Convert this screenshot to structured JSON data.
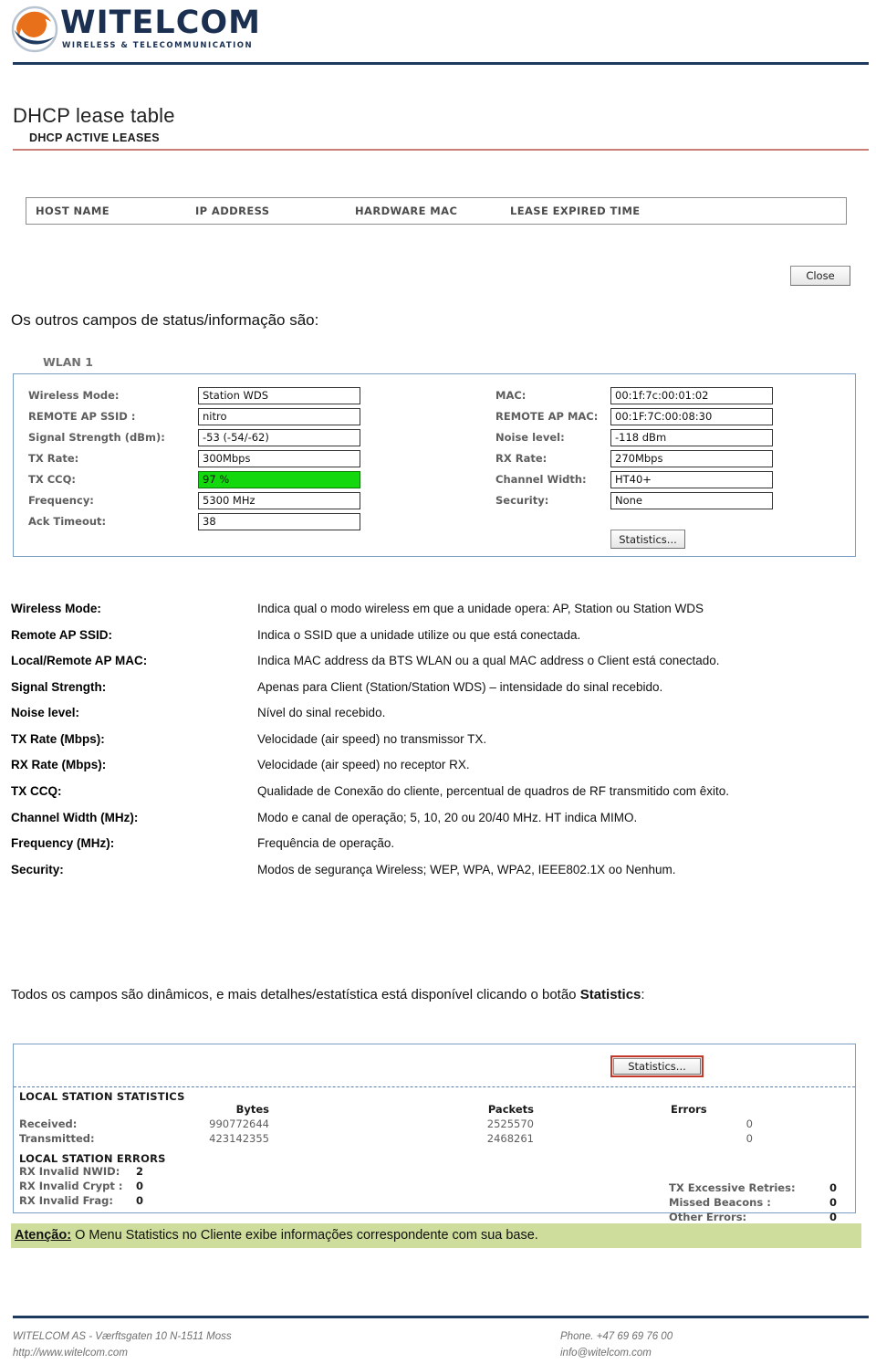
{
  "brand": {
    "logo_icon": "witelcom-swoosh-logo",
    "name": "WITELCOM",
    "tagline": "WIRELESS & TELECOMMUNICATION",
    "accent_navy": "#1f3a5f",
    "accent_orange": "#e8701a"
  },
  "dhcp": {
    "title": "DHCP lease table",
    "subtitle": "DHCP ACTIVE LEASES",
    "rule_color": "#c97f76",
    "columns": [
      "HOST NAME",
      "IP ADDRESS",
      "HARDWARE MAC",
      "LEASE EXPIRED TIME"
    ],
    "close_label": "Close"
  },
  "intro": "Os outros campos de status/informação são:",
  "wlan": {
    "panel_label": "WLAN 1",
    "left_fields": [
      {
        "label": "Wireless Mode:",
        "value": "Station WDS",
        "highlight": false
      },
      {
        "label": "REMOTE AP SSID :",
        "value": "nitro",
        "highlight": false
      },
      {
        "label": "Signal Strength (dBm):",
        "value": "-53 (-54/-62)",
        "highlight": false
      },
      {
        "label": "TX Rate:",
        "value": "300Mbps",
        "highlight": false
      },
      {
        "label": "TX CCQ:",
        "value": "97 %",
        "highlight": true
      },
      {
        "label": "Frequency:",
        "value": "5300 MHz",
        "highlight": false
      },
      {
        "label": "Ack Timeout:",
        "value": "38",
        "highlight": false
      }
    ],
    "right_fields": [
      {
        "label": "MAC:",
        "value": "00:1f:7c:00:01:02"
      },
      {
        "label": "REMOTE AP MAC:",
        "value": "00:1F:7C:00:08:30"
      },
      {
        "label": "Noise level:",
        "value": "-118 dBm"
      },
      {
        "label": "RX Rate:",
        "value": "270Mbps"
      },
      {
        "label": "Channel Width:",
        "value": "HT40+"
      },
      {
        "label": "Security:",
        "value": "None"
      }
    ],
    "statistics_label": "Statistics...",
    "highlight_color": "#13d80d"
  },
  "definitions": [
    {
      "term": "Wireless Mode:",
      "desc": "Indica qual o modo wireless em que a unidade opera: AP, Station ou Station WDS"
    },
    {
      "term": "Remote AP SSID:",
      "desc": "Indica o SSID que a unidade utilize ou que está conectada."
    },
    {
      "term": "Local/Remote AP MAC:",
      "desc": "Indica MAC address da BTS WLAN ou a qual MAC address o Client está conectado."
    },
    {
      "term": "Signal Strength:",
      "desc": "Apenas para Client (Station/Station WDS) – intensidade do sinal recebido."
    },
    {
      "term": "Noise level:",
      "desc": "Nível do sinal recebido."
    },
    {
      "term": "TX Rate (Mbps):",
      "desc": "Velocidade (air speed) no transmissor TX."
    },
    {
      "term": "RX Rate (Mbps):",
      "desc": "Velocidade (air speed) no receptor RX."
    },
    {
      "term": "TX CCQ:",
      "desc": "Qualidade de Conexão do cliente, percentual de quadros de RF transmitido com êxito."
    },
    {
      "term": "Channel Width (MHz):",
      "desc": "Modo e canal de operação; 5, 10, 20 ou 20/40 MHz. HT indica MIMO."
    },
    {
      "term": "Frequency (MHz):",
      "desc": "Frequência de operação."
    },
    {
      "term": "Security:",
      "desc": "Modos de segurança Wireless; WEP, WPA, WPA2, IEEE802.1X oo Nenhum."
    }
  ],
  "closing": {
    "text_before": "Todos os campos são dinâmicos, e mais detalhes/estatística está disponível clicando o botão ",
    "bold_word": "Statistics",
    "text_after": ":"
  },
  "statistics_panel": {
    "statistics_button": "Statistics...",
    "section_title": "LOCAL STATION STATISTICS",
    "errors_title": "LOCAL STATION ERRORS",
    "headers": {
      "bytes": "Bytes",
      "packets": "Packets",
      "errors": "Errors"
    },
    "rows": [
      {
        "label": "Received:",
        "bytes": "990772644",
        "packets": "2525570",
        "errors": "0"
      },
      {
        "label": "Transmitted:",
        "bytes": "423142355",
        "packets": "2468261",
        "errors": "0"
      }
    ],
    "errors_left": [
      {
        "key": "RX Invalid NWID:",
        "value": "2"
      },
      {
        "key": "RX Invalid Crypt :",
        "value": "0"
      },
      {
        "key": "RX Invalid Frag:",
        "value": "0"
      }
    ],
    "errors_right": [
      {
        "key": "TX Excessive Retries:",
        "value": "0"
      },
      {
        "key": "Missed Beacons :",
        "value": "0"
      },
      {
        "key": "Other Errors:",
        "value": "0"
      }
    ],
    "highlight_border_color": "#c0392b"
  },
  "attention": {
    "label": "Atenção:",
    "text": " O Menu Statistics no Cliente exibe informações correspondente com sua base.",
    "bg_color": "#cedd9b"
  },
  "footer": {
    "address": "WITELCOM AS - Værftsgaten 10 N-1511 Moss",
    "website": "http://www.witelcom.com",
    "phone": "Phone. +47 69 69 76 00",
    "email": "info@witelcom.com"
  }
}
